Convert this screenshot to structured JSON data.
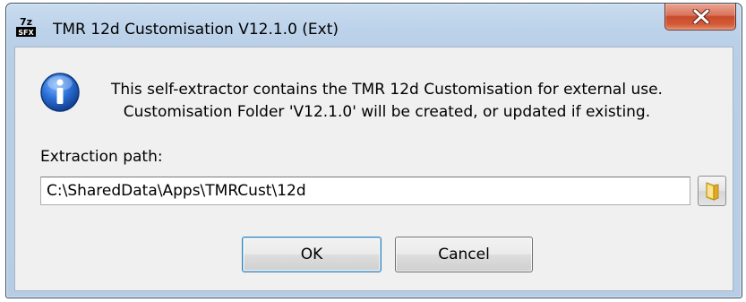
{
  "window": {
    "title": "TMR 12d Customisation V12.1.0 (Ext)",
    "app_icon": "7z-sfx-icon",
    "close_icon": "close-icon"
  },
  "message": {
    "icon": "info-icon",
    "line1": "This self-extractor contains the TMR 12d Customisation for external use.",
    "line2": "Customisation Folder 'V12.1.0' will be created, or updated if existing."
  },
  "extraction": {
    "label": "Extraction path:",
    "value": "C:\\SharedData\\Apps\\TMRCust\\12d",
    "browse_icon": "folder-icon"
  },
  "buttons": {
    "ok_label": "OK",
    "cancel_label": "Cancel"
  },
  "colors": {
    "close_button": "#c74a2c",
    "title_bar": "#bcd2ea",
    "dialog_background": "#f0f0f0",
    "default_button_border": "#3c7fb1"
  }
}
